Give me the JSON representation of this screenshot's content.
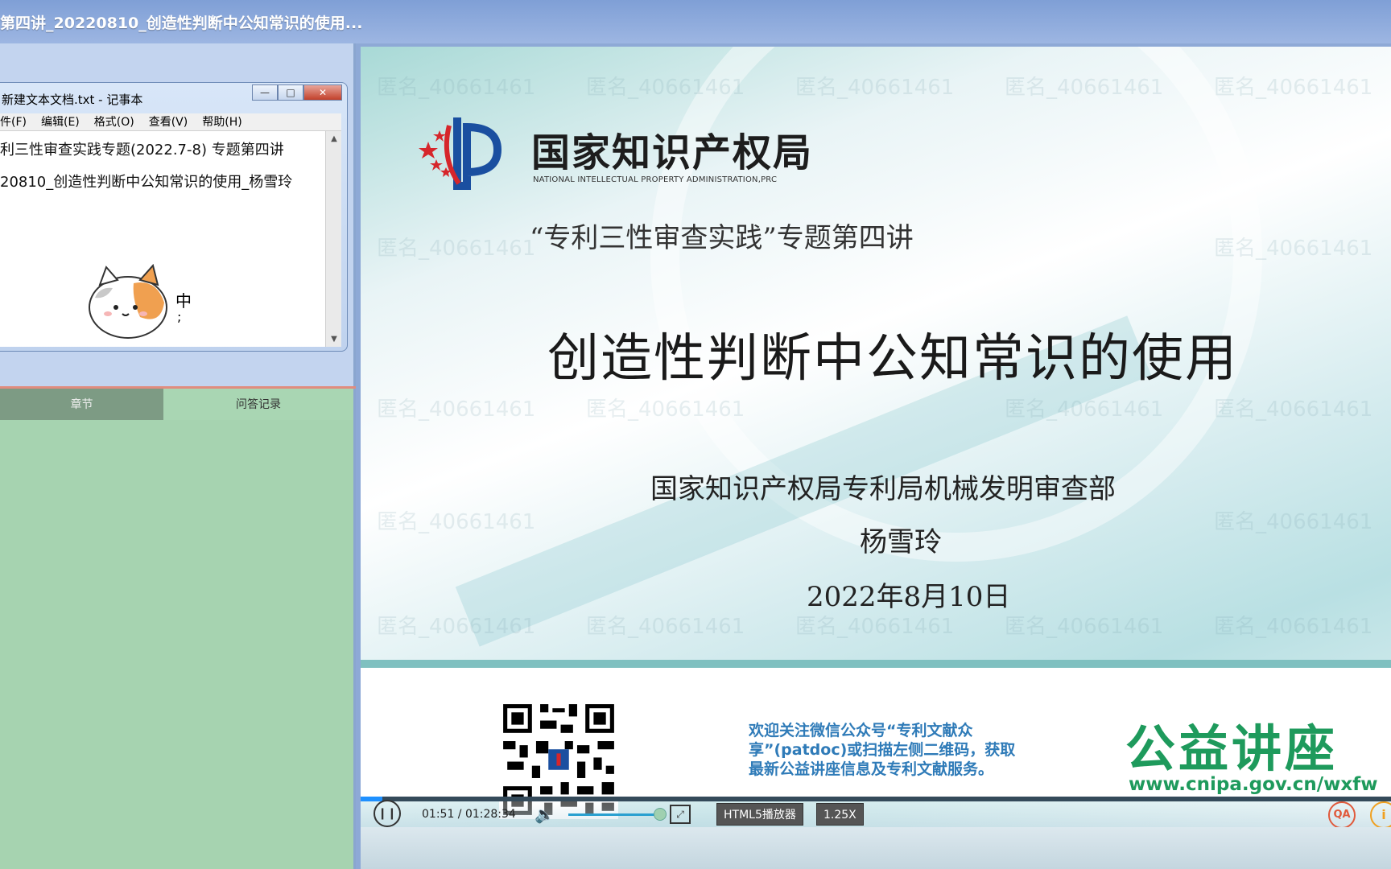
{
  "window": {
    "title": "第四讲_20220810_创造性判断中公知常识的使用..."
  },
  "notepad": {
    "title": "新建文本文档.txt - 记事本",
    "buttons": {
      "minimize": "—",
      "maximize": "□",
      "close": "✕"
    },
    "menu": [
      "件(F)",
      "编辑(E)",
      "格式(O)",
      "查看(V)",
      "帮助(H)"
    ],
    "lines": [
      "利三性审查实践专题(2022.7-8) 专题第四讲",
      "20810_创造性判断中公知常识的使用_杨雪玲"
    ],
    "ime_char": "中",
    "ime_punct": ";"
  },
  "tabs": {
    "chapters": "章节",
    "qa_records": "问答记录"
  },
  "slide": {
    "org_cn": "国家知识产权局",
    "org_en": "NATIONAL INTELLECTUAL PROPERTY ADMINISTRATION,PRC",
    "subtitle": "“专利三性审查实践”专题第四讲",
    "title": "创造性判断中公知常识的使用",
    "department": "国家知识产权局专利局机械发明审查部",
    "speaker": "杨雪玲",
    "date": "2022年8月10日",
    "watermark": "匿名_40661461",
    "notice": "欢迎关注微信公众号“专利文献众享”(patdoc)或扫描左侧二维码，获取最新公益讲座信息及专利文献服务。",
    "lecture_label": "公益讲座",
    "url": "www.cnipa.gov.cn/wxfw"
  },
  "player": {
    "time": "01:51 / 01:28:34",
    "progress_fraction": 0.021,
    "volume_fraction": 0.85,
    "play_icon": "❙❙",
    "volume_icon": "🔈",
    "fullscreen_icon": "⤢",
    "html5_label": "HTML5播放器",
    "speed_label": "1.25X",
    "qa_label": "QA",
    "info_label": "i"
  },
  "colors": {
    "accent_blue": "#1e90ff",
    "lecture_green": "#1e9a5c",
    "notice_blue": "#2f7bb8",
    "tab_active": "#a9d6b3"
  }
}
